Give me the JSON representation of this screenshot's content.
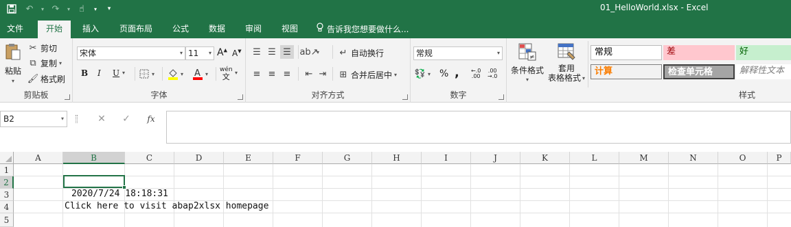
{
  "window": {
    "title": "01_HelloWorld.xlsx - Excel"
  },
  "qat": {
    "icons": [
      "save-icon",
      "undo-icon",
      "redo-icon",
      "touch-mode-icon",
      "customize-qat-icon"
    ]
  },
  "tabs": [
    {
      "label": "文件",
      "active": false
    },
    {
      "label": "开始",
      "active": true
    },
    {
      "label": "插入",
      "active": false
    },
    {
      "label": "页面布局",
      "active": false
    },
    {
      "label": "公式",
      "active": false
    },
    {
      "label": "数据",
      "active": false
    },
    {
      "label": "审阅",
      "active": false
    },
    {
      "label": "视图",
      "active": false
    }
  ],
  "tell_me": "告诉我您想要做什么...",
  "ribbon": {
    "clipboard": {
      "label": "剪贴板",
      "paste": "粘贴",
      "cut": "剪切",
      "copy": "复制",
      "format_painter": "格式刷"
    },
    "font": {
      "label": "字体",
      "font_name": "宋体",
      "font_size": "11",
      "bold": "B",
      "italic": "I",
      "underline": "U",
      "wen": "wén"
    },
    "alignment": {
      "label": "对齐方式",
      "wrap_text": "自动换行",
      "merge_center": "合并后居中"
    },
    "number": {
      "label": "数字",
      "format": "常规",
      "percent": "%",
      "comma": ",",
      "inc_decimal": "←.0 .00",
      "dec_decimal": ".00 →.0"
    },
    "styles": {
      "label": "样式",
      "conditional_formatting": "条件格式",
      "format_as_table_line1": "套用",
      "format_as_table_line2": "表格格式",
      "cells": [
        {
          "text": "常规",
          "bg": "#ffffff",
          "color": "#000000"
        },
        {
          "text": "差",
          "bg": "#ffc7ce",
          "color": "#9c0006"
        },
        {
          "text": "好",
          "bg": "#c6efce",
          "color": "#006100"
        },
        {
          "text": "计算",
          "bg": "#f2f2f2",
          "color": "#fa7d00"
        },
        {
          "text": "检查单元格",
          "bg": "#a5a5a5",
          "color": "#ffffff"
        },
        {
          "text": "解释性文本",
          "bg": "#ffffff",
          "color": "#7f7f7f"
        }
      ]
    }
  },
  "formula_bar": {
    "name_box": "B2",
    "cancel": "✕",
    "enter": "✓",
    "fx": "fx",
    "value": ""
  },
  "sheet": {
    "columns": [
      "A",
      "B",
      "C",
      "D",
      "E",
      "F",
      "G",
      "H",
      "I",
      "J",
      "K",
      "L",
      "M",
      "N",
      "O",
      "P"
    ],
    "rows": [
      "1",
      "2",
      "3",
      "4",
      "5"
    ],
    "selected_cell": "B2",
    "cells": {
      "B3": "2020/7/24 18:18:31",
      "B4": "Click here to visit abap2xlsx homepage"
    }
  },
  "colors": {
    "accent": "#217346",
    "ribbon_bg": "#f3f3f3"
  }
}
